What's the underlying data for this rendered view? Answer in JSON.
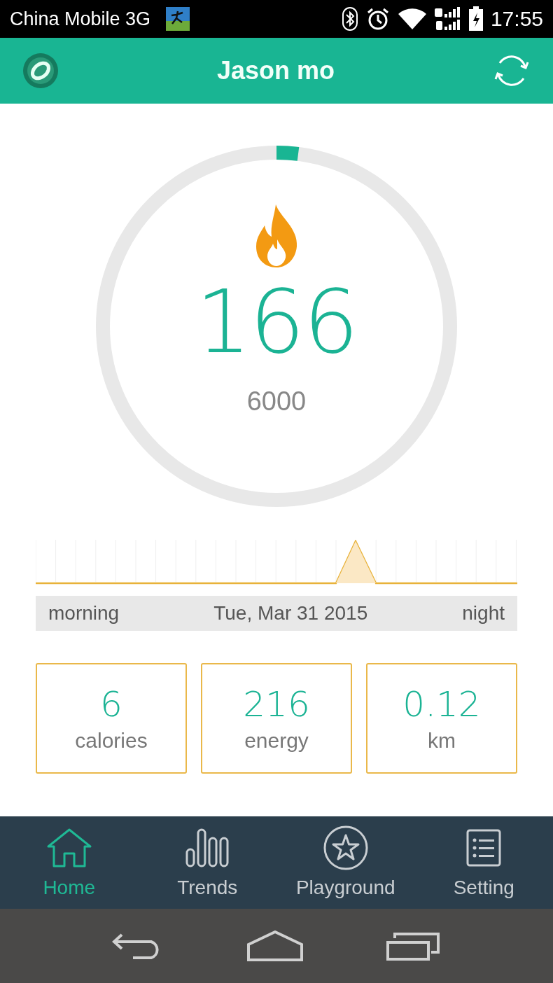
{
  "status_bar": {
    "carrier": "China Mobile 3G",
    "time": "17:55"
  },
  "app_bar": {
    "title": "Jason mo"
  },
  "goal_ring": {
    "level": 0.02,
    "value": "166",
    "goal": "6000"
  },
  "timeline": {
    "start_label": "morning",
    "date": "Tue, Mar 31 2015",
    "end_label": "night"
  },
  "stats": [
    {
      "value": "6",
      "label": "calories"
    },
    {
      "value": "216",
      "label": "energy"
    },
    {
      "value": "0.12",
      "label": "km"
    }
  ],
  "tabs": [
    {
      "label": "Home",
      "kind": "home",
      "selected": true
    },
    {
      "label": "Trends",
      "kind": "trends",
      "selected": false
    },
    {
      "label": "Playground",
      "kind": "playground",
      "selected": false
    },
    {
      "label": "Setting",
      "kind": "setting",
      "selected": false
    }
  ]
}
